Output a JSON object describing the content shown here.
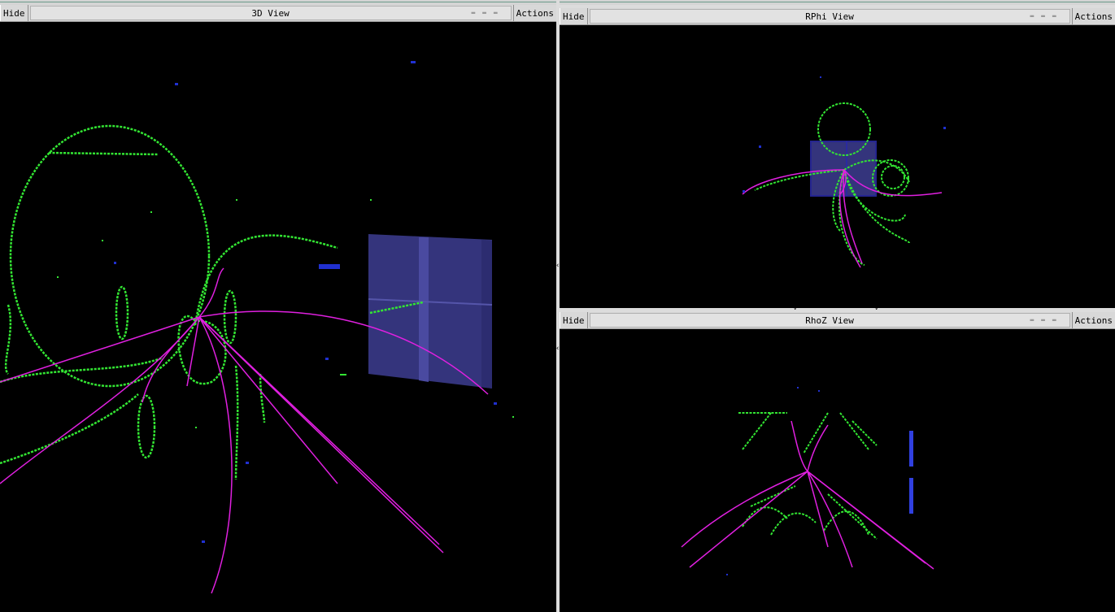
{
  "views": [
    {
      "id": "3d",
      "hide_label": "Hide",
      "title": "3D View",
      "actions_label": "Actions"
    },
    {
      "id": "rphi",
      "hide_label": "Hide",
      "title": "RPhi View",
      "actions_label": "Actions"
    },
    {
      "id": "rhoz",
      "hide_label": "Hide",
      "title": "RhoZ View",
      "actions_label": "Actions"
    }
  ],
  "colors": {
    "background": "#000000",
    "track_green": "#33e633",
    "track_magenta": "#e020e0",
    "hit_blue": "#2030d0",
    "detector_box": "#3a3a8a"
  }
}
